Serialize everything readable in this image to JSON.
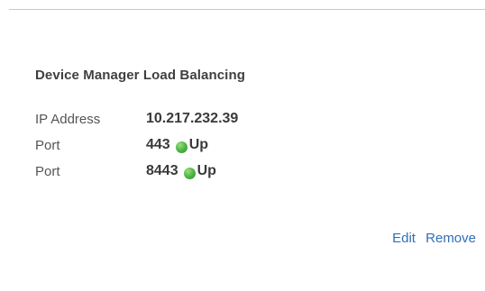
{
  "panel": {
    "title": "Device Manager Load Balancing"
  },
  "details": {
    "ip": {
      "label": "IP Address",
      "value": "10.217.232.39"
    },
    "ports": [
      {
        "label": "Port",
        "value": "443",
        "status": "Up",
        "status_color": "#54b94a"
      },
      {
        "label": "Port",
        "value": "8443",
        "status": "Up",
        "status_color": "#54b94a"
      }
    ]
  },
  "actions": {
    "edit_label": "Edit",
    "remove_label": "Remove"
  },
  "colors": {
    "link": "#2f6fb7",
    "status_up": "#54b94a"
  }
}
